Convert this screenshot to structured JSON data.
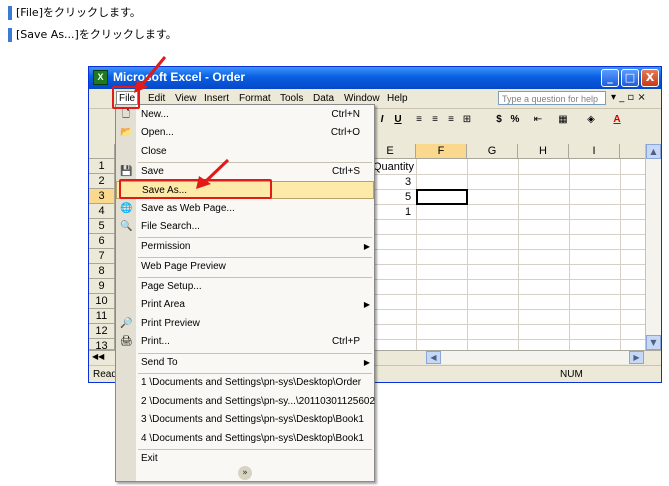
{
  "instructions": [
    "[File]をクリックします。",
    "[Save As...]をクリックします。"
  ],
  "window": {
    "title": "Microsoft Excel - Order",
    "minimize_label": "_",
    "maximize_label": "□",
    "close_label": "X"
  },
  "menubar": {
    "items": [
      "File",
      "Edit",
      "View",
      "Insert",
      "Format",
      "Tools",
      "Data",
      "Window",
      "Help"
    ],
    "help_placeholder": "Type a question for help",
    "right_controls": "▾ _ ▫ ×"
  },
  "toolbar": {
    "italic": "I",
    "underline": "U",
    "currency": "$",
    "percent": "%",
    "font_color": "A"
  },
  "sheet": {
    "columns": [
      "E",
      "F",
      "G",
      "H",
      "I"
    ],
    "selected_column": "F",
    "rows": [
      "1",
      "2",
      "3",
      "4",
      "5",
      "6",
      "7",
      "8",
      "9",
      "10",
      "11",
      "12",
      "13"
    ],
    "selected_row": "3",
    "cells": {
      "E1": "Quantity",
      "E2": "3",
      "E3": "5",
      "E4": "1"
    }
  },
  "status": {
    "left": "Ready",
    "num": "NUM"
  },
  "file_menu": {
    "items": [
      {
        "label": "New...",
        "shortcut": "Ctrl+N",
        "icon": "new-doc-icon",
        "glyph": "🗋"
      },
      {
        "label": "Open...",
        "shortcut": "Ctrl+O",
        "icon": "open-folder-icon",
        "glyph": "📂"
      },
      {
        "label": "Close",
        "shortcut": "",
        "icon": "",
        "glyph": ""
      },
      {
        "label": "Save",
        "shortcut": "Ctrl+S",
        "icon": "save-icon",
        "glyph": "💾"
      },
      {
        "label": "Save As...",
        "shortcut": "",
        "icon": "",
        "glyph": ""
      },
      {
        "label": "Save as Web Page...",
        "shortcut": "",
        "icon": "web-page-icon",
        "glyph": "🌐"
      },
      {
        "label": "File Search...",
        "shortcut": "",
        "icon": "file-search-icon",
        "glyph": "🔍"
      },
      {
        "label": "Permission",
        "shortcut": "",
        "icon": "",
        "glyph": "",
        "submenu": true
      },
      {
        "label": "Web Page Preview",
        "shortcut": "",
        "icon": "",
        "glyph": ""
      },
      {
        "label": "Page Setup...",
        "shortcut": "",
        "icon": "",
        "glyph": ""
      },
      {
        "label": "Print Area",
        "shortcut": "",
        "icon": "",
        "glyph": "",
        "submenu": true
      },
      {
        "label": "Print Preview",
        "shortcut": "",
        "icon": "print-preview-icon",
        "glyph": "🔎"
      },
      {
        "label": "Print...",
        "shortcut": "Ctrl+P",
        "icon": "print-icon",
        "glyph": "🖨"
      },
      {
        "label": "Send To",
        "shortcut": "",
        "icon": "",
        "glyph": "",
        "submenu": true
      },
      {
        "label": "1 \\Documents and Settings\\pn-sys\\Desktop\\Order",
        "shortcut": "",
        "icon": "",
        "glyph": ""
      },
      {
        "label": "2 \\Documents and Settings\\pn-sy...\\20110301125602",
        "shortcut": "",
        "icon": "",
        "glyph": ""
      },
      {
        "label": "3 \\Documents and Settings\\pn-sys\\Desktop\\Book1",
        "shortcut": "",
        "icon": "",
        "glyph": ""
      },
      {
        "label": "4 \\Documents and Settings\\pn-sys\\Desktop\\Book1",
        "shortcut": "",
        "icon": "",
        "glyph": ""
      },
      {
        "label": "Exit",
        "shortcut": "",
        "icon": "",
        "glyph": ""
      }
    ],
    "expand_glyph": "»"
  },
  "colors": {
    "accent_red": "#e21a1a",
    "highlight": "#fde9a8",
    "title_blue": "#0a5fe0"
  }
}
